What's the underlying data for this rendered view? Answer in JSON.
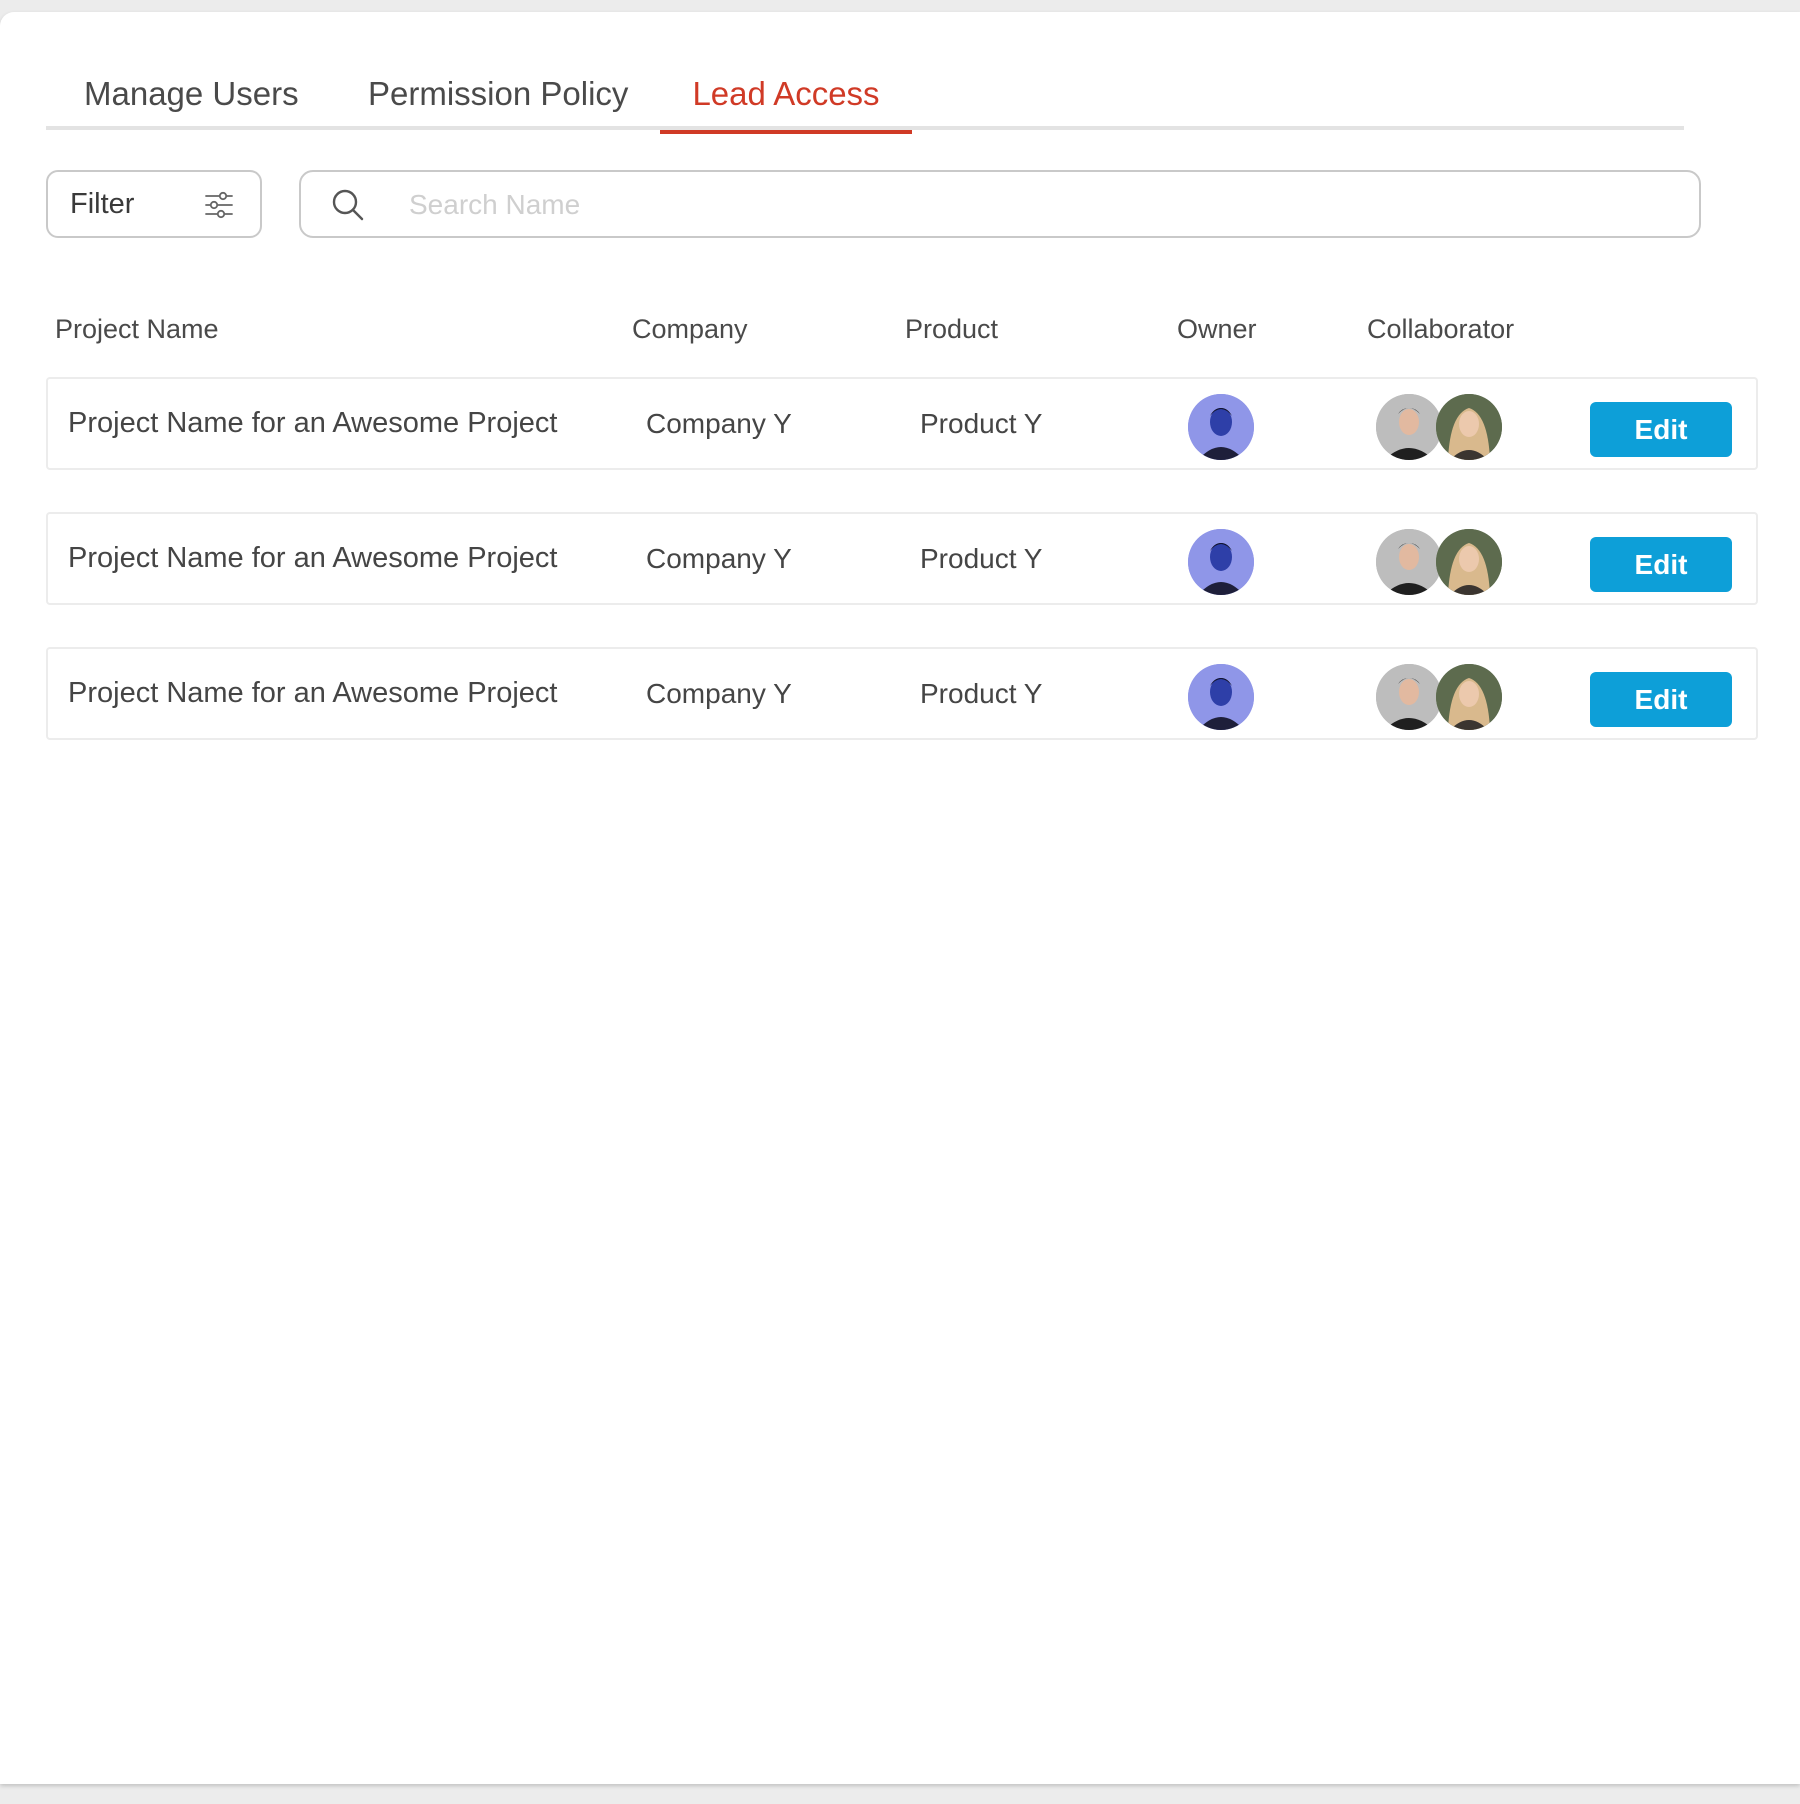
{
  "tabs": [
    {
      "label": "Manage Users",
      "active": false
    },
    {
      "label": "Permission Policy",
      "active": false
    },
    {
      "label": "Lead Access",
      "active": true
    }
  ],
  "filter": {
    "label": "Filter",
    "icon": "sliders-icon"
  },
  "search": {
    "placeholder": "Search Name",
    "value": "",
    "icon": "search-icon"
  },
  "table": {
    "headers": [
      "Project Name",
      "Company",
      "Product",
      "Owner",
      "Collaborator"
    ],
    "rows": [
      {
        "project": "Project Name for an Awesome Project",
        "company": "Company Y",
        "product": "Product Y",
        "edit_label": "Edit"
      },
      {
        "project": "Project Name for an Awesome Project",
        "company": "Company Y",
        "product": "Product Y",
        "edit_label": "Edit"
      },
      {
        "project": "Project Name for an Awesome Project",
        "company": "Company Y",
        "product": "Product Y",
        "edit_label": "Edit"
      }
    ]
  },
  "colors": {
    "accent_tab": "#d03a26",
    "button": "#0d9fd8",
    "border": "#c9c9c9"
  }
}
